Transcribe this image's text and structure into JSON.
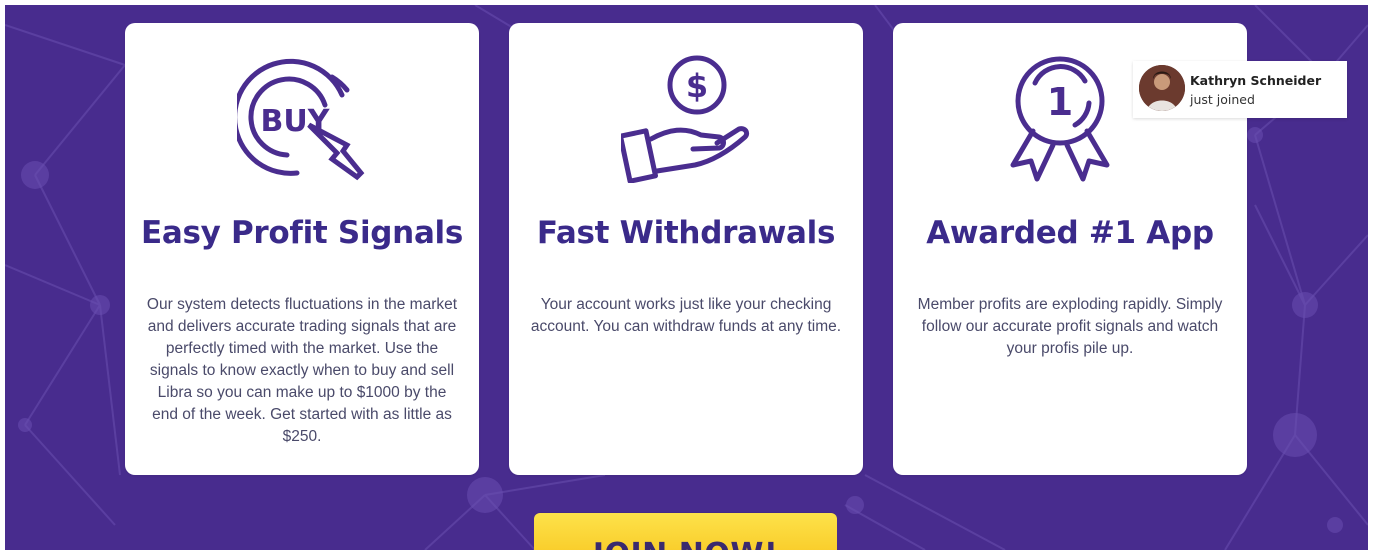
{
  "features": [
    {
      "icon": "buy-click-icon",
      "icon_text": "BUY",
      "title": "Easy Profit Signals",
      "text": "Our system detects fluctuations in the market and delivers accurate trading signals that are perfectly timed with the market. Use the signals to know exactly when to buy and sell Libra so you can make up to $1000 by the end of the week. Get started with as little as $250."
    },
    {
      "icon": "money-hand-icon",
      "icon_text": "$",
      "title": "Fast Withdrawals",
      "text": "Your account works just like your checking account. You can withdraw funds at any time."
    },
    {
      "icon": "award-medal-icon",
      "icon_text": "1",
      "title": "Awarded #1 App",
      "text": "Member profits are exploding rapidly. Simply follow our accurate profit signals and watch your profis pile up."
    }
  ],
  "notification": {
    "name": "Kathryn Schneider",
    "status": "just joined",
    "avatar_icon": "user-avatar"
  },
  "cta": {
    "label": "JOIN NOW!"
  },
  "colors": {
    "background": "#482c8e",
    "card": "#ffffff",
    "title": "#3a2a8a",
    "icon": "#4a2d8f",
    "cta": "#f9cf2a"
  }
}
